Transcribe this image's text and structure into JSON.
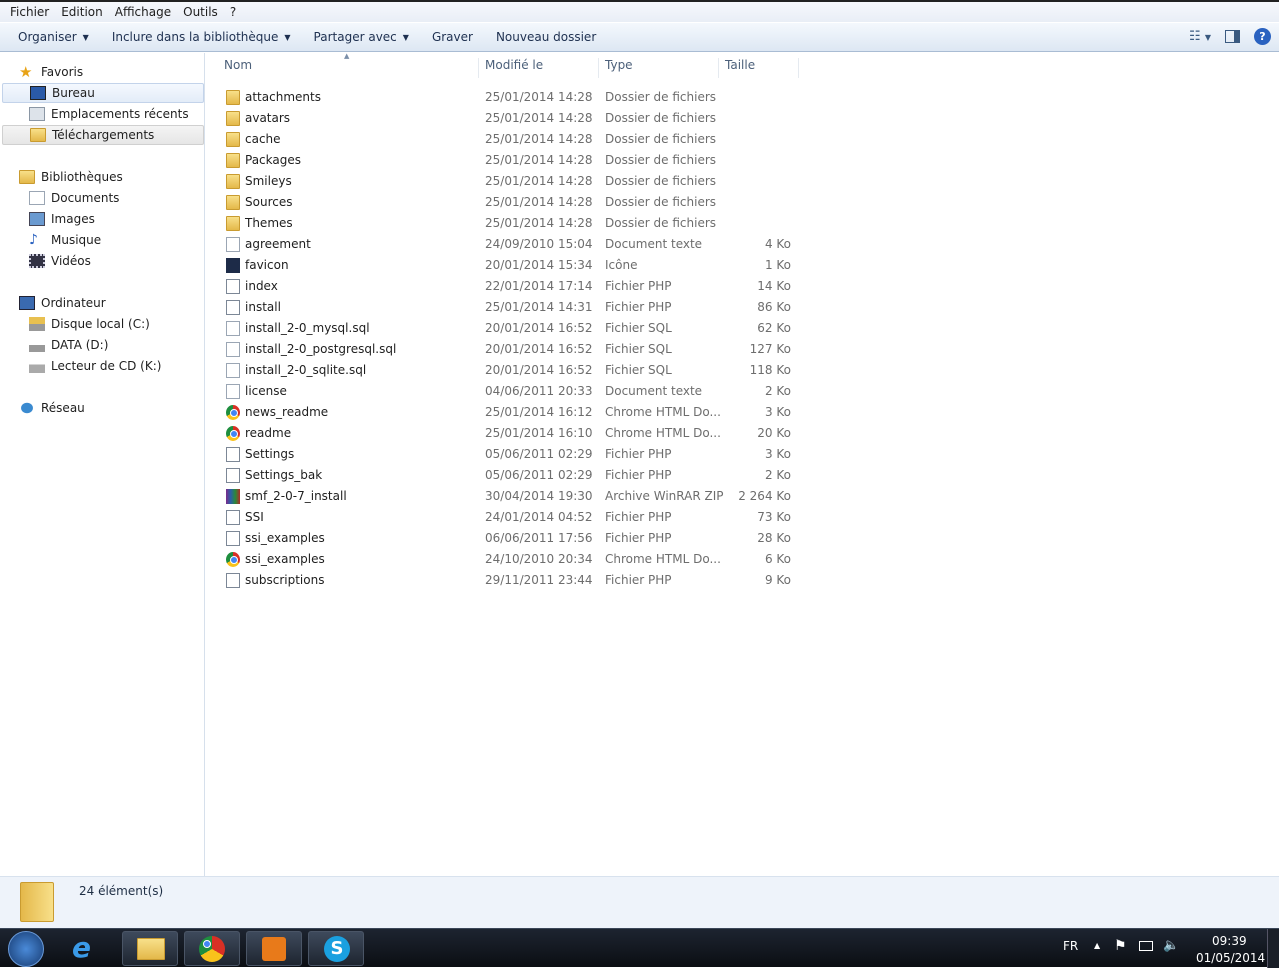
{
  "menu": [
    "Fichier",
    "Edition",
    "Affichage",
    "Outils",
    "?"
  ],
  "toolbar": {
    "organize": "Organiser",
    "include": "Inclure dans la bibliothèque",
    "share": "Partager avec",
    "burn": "Graver",
    "new_folder": "Nouveau dossier"
  },
  "sidebar": {
    "favorites": "Favoris",
    "desktop": "Bureau",
    "recent": "Emplacements récents",
    "downloads": "Téléchargements",
    "libraries": "Bibliothèques",
    "documents": "Documents",
    "images": "Images",
    "music": "Musique",
    "videos": "Vidéos",
    "computer": "Ordinateur",
    "disk_c": "Disque local (C:)",
    "data_d": "DATA (D:)",
    "cd_k": "Lecteur de CD (K:)",
    "network": "Réseau"
  },
  "columns": {
    "name": "Nom",
    "modified": "Modifié le",
    "type": "Type",
    "size": "Taille"
  },
  "files": [
    {
      "name": "attachments",
      "date": "25/01/2014 14:28",
      "type": "Dossier de fichiers",
      "size": "",
      "icon": "folder"
    },
    {
      "name": "avatars",
      "date": "25/01/2014 14:28",
      "type": "Dossier de fichiers",
      "size": "",
      "icon": "folder"
    },
    {
      "name": "cache",
      "date": "25/01/2014 14:28",
      "type": "Dossier de fichiers",
      "size": "",
      "icon": "folder"
    },
    {
      "name": "Packages",
      "date": "25/01/2014 14:28",
      "type": "Dossier de fichiers",
      "size": "",
      "icon": "folder"
    },
    {
      "name": "Smileys",
      "date": "25/01/2014 14:28",
      "type": "Dossier de fichiers",
      "size": "",
      "icon": "folder"
    },
    {
      "name": "Sources",
      "date": "25/01/2014 14:28",
      "type": "Dossier de fichiers",
      "size": "",
      "icon": "folder"
    },
    {
      "name": "Themes",
      "date": "25/01/2014 14:28",
      "type": "Dossier de fichiers",
      "size": "",
      "icon": "folder"
    },
    {
      "name": "agreement",
      "date": "24/09/2010 15:04",
      "type": "Document texte",
      "size": "4 Ko",
      "icon": "doc"
    },
    {
      "name": "favicon",
      "date": "20/01/2014 15:34",
      "type": "Icône",
      "size": "1 Ko",
      "icon": "fav"
    },
    {
      "name": "index",
      "date": "22/01/2014 17:14",
      "type": "Fichier PHP",
      "size": "14 Ko",
      "icon": "php"
    },
    {
      "name": "install",
      "date": "25/01/2014 14:31",
      "type": "Fichier PHP",
      "size": "86 Ko",
      "icon": "php"
    },
    {
      "name": "install_2-0_mysql.sql",
      "date": "20/01/2014 16:52",
      "type": "Fichier SQL",
      "size": "62 Ko",
      "icon": "doc"
    },
    {
      "name": "install_2-0_postgresql.sql",
      "date": "20/01/2014 16:52",
      "type": "Fichier SQL",
      "size": "127 Ko",
      "icon": "doc"
    },
    {
      "name": "install_2-0_sqlite.sql",
      "date": "20/01/2014 16:52",
      "type": "Fichier SQL",
      "size": "118 Ko",
      "icon": "doc"
    },
    {
      "name": "license",
      "date": "04/06/2011 20:33",
      "type": "Document texte",
      "size": "2 Ko",
      "icon": "doc"
    },
    {
      "name": "news_readme",
      "date": "25/01/2014 16:12",
      "type": "Chrome HTML Do...",
      "size": "3 Ko",
      "icon": "chrome"
    },
    {
      "name": "readme",
      "date": "25/01/2014 16:10",
      "type": "Chrome HTML Do...",
      "size": "20 Ko",
      "icon": "chrome"
    },
    {
      "name": "Settings",
      "date": "05/06/2011 02:29",
      "type": "Fichier PHP",
      "size": "3 Ko",
      "icon": "php"
    },
    {
      "name": "Settings_bak",
      "date": "05/06/2011 02:29",
      "type": "Fichier PHP",
      "size": "2 Ko",
      "icon": "php"
    },
    {
      "name": "smf_2-0-7_install",
      "date": "30/04/2014 19:30",
      "type": "Archive WinRAR ZIP",
      "size": "2 264 Ko",
      "icon": "rar"
    },
    {
      "name": "SSI",
      "date": "24/01/2014 04:52",
      "type": "Fichier PHP",
      "size": "73 Ko",
      "icon": "php"
    },
    {
      "name": "ssi_examples",
      "date": "06/06/2011 17:56",
      "type": "Fichier PHP",
      "size": "28 Ko",
      "icon": "php"
    },
    {
      "name": "ssi_examples",
      "date": "24/10/2010 20:34",
      "type": "Chrome HTML Do...",
      "size": "6 Ko",
      "icon": "chrome"
    },
    {
      "name": "subscriptions",
      "date": "29/11/2011 23:44",
      "type": "Fichier PHP",
      "size": "9 Ko",
      "icon": "php"
    }
  ],
  "status": {
    "count": "24 élément(s)"
  },
  "taskbar": {
    "lang": "FR",
    "time": "09:39",
    "date": "01/05/2014"
  }
}
